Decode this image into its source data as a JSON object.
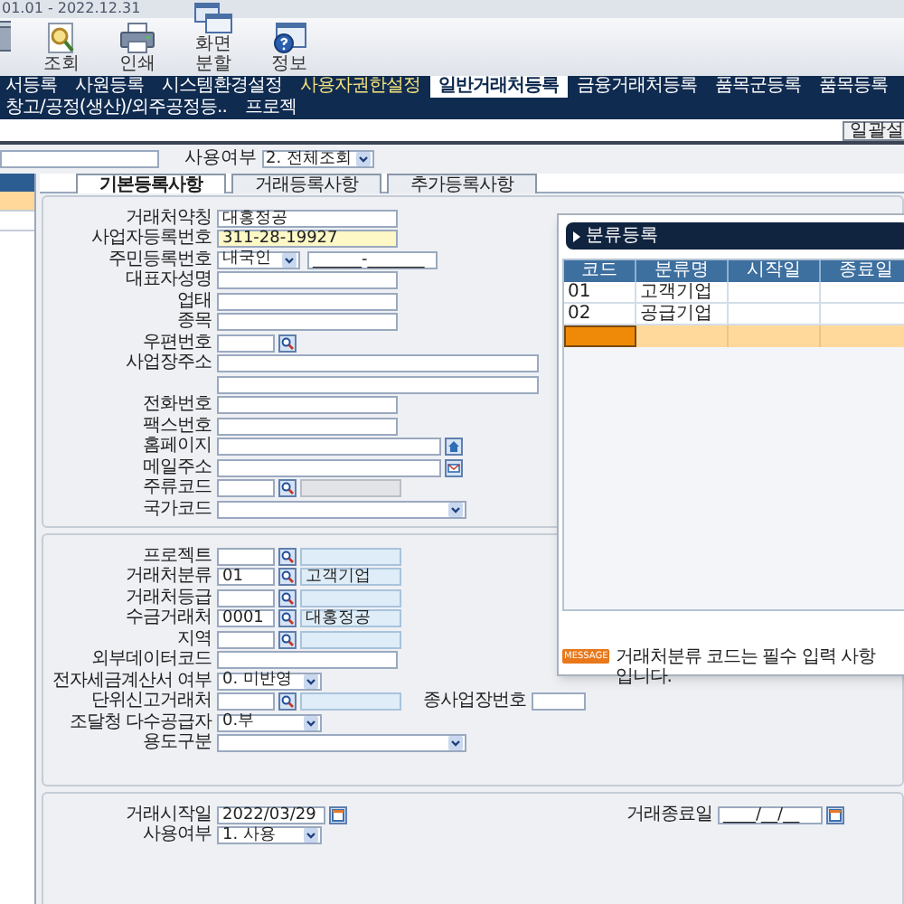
{
  "period": "01.01 - 2022.12.31",
  "toolbar": [
    {
      "kind": "delete"
    },
    {
      "kind": "search",
      "label": "조회"
    },
    {
      "kind": "print",
      "label": "인쇄"
    },
    {
      "kind": "split",
      "label": "화면분할"
    },
    {
      "kind": "info",
      "label": "정보"
    }
  ],
  "menu_tabs": [
    {
      "label": "서등록",
      "selected": false,
      "highlighted": false
    },
    {
      "label": "사원등록",
      "selected": false,
      "highlighted": false
    },
    {
      "label": "시스템환경설정",
      "selected": false,
      "highlighted": false
    },
    {
      "label": "사용자권한설정",
      "selected": false,
      "highlighted": true
    },
    {
      "label": "일반거래처등록",
      "selected": true,
      "highlighted": false
    },
    {
      "label": "금융거래처등록",
      "selected": false,
      "highlighted": false
    },
    {
      "label": "품목군등록",
      "selected": false,
      "highlighted": false
    },
    {
      "label": "품목등록",
      "selected": false,
      "highlighted": false
    },
    {
      "label": "창고/공정(생산)/외주공정등..",
      "selected": false,
      "highlighted": false
    },
    {
      "label": "프로젝",
      "selected": false,
      "highlighted": false
    }
  ],
  "batch_button": "일괄설",
  "filter": {
    "label": "사용여부",
    "value": "2. 전체조회"
  },
  "side_list": [
    {
      "selected": true
    },
    {
      "selected": false
    }
  ],
  "form_tabs": [
    {
      "label": "기본등록사항",
      "selected": true
    },
    {
      "label": "거래등록사항",
      "selected": false
    },
    {
      "label": "추가등록사항",
      "selected": false
    }
  ],
  "basic_fields": [
    {
      "kind": "text",
      "label": "거래처약칭",
      "value": "대홍정공",
      "highlighted": false
    },
    {
      "kind": "text",
      "label": "사업자등록번호",
      "value": "311-28-19927",
      "highlighted": true
    },
    {
      "kind": "select_text",
      "label": "주민등록번호",
      "value": "내국인",
      "value2": "______-_______"
    },
    {
      "kind": "text",
      "label": "대표자성명",
      "highlighted": false
    },
    {
      "kind": "text",
      "label": "업태",
      "highlighted": false
    },
    {
      "kind": "text",
      "label": "종목",
      "highlighted": false
    },
    {
      "kind": "zip",
      "label": "우편번호"
    },
    {
      "kind": "address",
      "label": "사업장주소"
    },
    {
      "kind": "text",
      "label": "전화번호",
      "highlighted": false
    },
    {
      "kind": "text",
      "label": "팩스번호",
      "highlighted": false
    },
    {
      "kind": "url",
      "label": "홈페이지"
    },
    {
      "kind": "email",
      "label": "메일주소"
    },
    {
      "kind": "code_readonly",
      "label": "주류코드"
    },
    {
      "kind": "select",
      "label": "국가코드"
    }
  ],
  "detail_fields": [
    {
      "kind": "lookup",
      "label": "프로젝트"
    },
    {
      "kind": "lookup",
      "label": "거래처분류",
      "value": "01",
      "desc": "고객기업"
    },
    {
      "kind": "lookup",
      "label": "거래처등급"
    },
    {
      "kind": "lookup",
      "label": "수금거래처",
      "value": "0001",
      "desc": "대홍정공"
    },
    {
      "kind": "lookup",
      "label": "지역"
    },
    {
      "kind": "text",
      "label": "외부데이터코드",
      "highlighted": false
    },
    {
      "kind": "select_short",
      "label": "전자세금계산서 여부",
      "value": "0. 미반영"
    },
    {
      "kind": "lookup",
      "label": "단위신고거래처",
      "extra_label": "종사업장번호"
    },
    {
      "kind": "select_short",
      "label": "조달청 다수공급자",
      "value": "0.부"
    },
    {
      "kind": "select",
      "label": "용도구분"
    }
  ],
  "period_fields": {
    "start": {
      "label": "거래시작일",
      "value": "2022/03/29"
    },
    "end": {
      "label": "거래종료일",
      "value": "____/__/__"
    },
    "usage": {
      "label": "사용여부",
      "value": "1. 사용"
    }
  },
  "popup": {
    "title": "분류등록",
    "columns": [
      "코드",
      "분류명",
      "시작일",
      "종료일"
    ],
    "rows": [
      {
        "cells": [
          "01",
          "고객기업"
        ],
        "selected": false
      },
      {
        "cells": [
          "02",
          "공급기업"
        ],
        "selected": false
      },
      {
        "cells": [],
        "selected": true
      }
    ],
    "message_badge": "MESSAGE",
    "message": "거래처분류 코드는 필수 입력 사항입니다."
  }
}
